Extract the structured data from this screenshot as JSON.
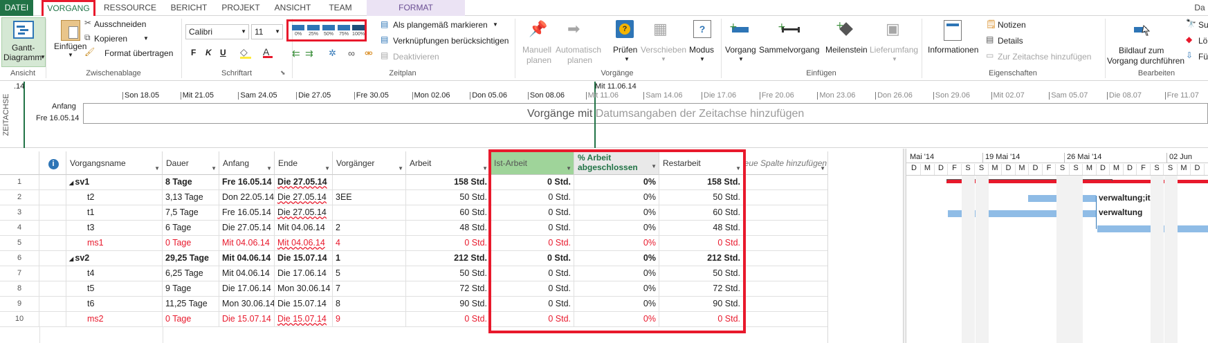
{
  "tabs": [
    {
      "label": "DATEI"
    },
    {
      "label": "VORGANG"
    },
    {
      "label": "RESSOURCE"
    },
    {
      "label": "BERICHT"
    },
    {
      "label": "PROJEKT"
    },
    {
      "label": "ANSICHT"
    },
    {
      "label": "TEAM"
    },
    {
      "label": "FORMAT"
    },
    {
      "label": "Da"
    }
  ],
  "ribbon": {
    "ansicht": {
      "gantt_line1": "Gantt-",
      "gantt_line2": "Diagramm",
      "group": "Ansicht"
    },
    "zwischenablage": {
      "paste": "Einfügen",
      "cut": "Ausschneiden",
      "copy": "Kopieren",
      "format_painter": "Format übertragen",
      "group": "Zwischenablage"
    },
    "schriftart": {
      "font": "Calibri",
      "size": "11",
      "bold": "F",
      "italic": "K",
      "underline": "U",
      "group": "Schriftart"
    },
    "zeitplan": {
      "pct": [
        "0%",
        "25%",
        "50%",
        "75%",
        "100%"
      ],
      "mark_on_track": "Als plangemäß markieren",
      "respect_links": "Verknüpfungen berücksichtigen",
      "deactivate": "Deaktivieren",
      "group": "Zeitplan"
    },
    "vorgaenge": {
      "manual1": "Manuell",
      "manual2": "planen",
      "auto1": "Automatisch",
      "auto2": "planen",
      "inspect": "Prüfen",
      "move": "Verschieben",
      "mode": "Modus",
      "group": "Vorgänge"
    },
    "einfuegen": {
      "task": "Vorgang",
      "summary": "Sammelvorgang",
      "milestone": "Meilenstein",
      "deliverable": "Lieferumfang",
      "group": "Einfügen"
    },
    "eigenschaften": {
      "info": "Informationen",
      "notes": "Notizen",
      "details": "Details",
      "add_timeline": "Zur Zeitachse hinzufügen",
      "group": "Eigenschaften"
    },
    "bearbeiten": {
      "scroll1": "Bildlauf zum",
      "scroll2": "Vorgang durchführen",
      "su": "Su",
      "lo": "Lö",
      "fu": "Fü",
      "group": "Bearbeiten"
    }
  },
  "timeline": {
    "side_label": "ZEITACHSE",
    "start_label": "Anfang",
    "start_date": "Fre 16.05.14",
    "left_mark": ".14",
    "today": "Mit 11.06.14",
    "placeholder_a": "Vorgänge mit",
    "placeholder_b": " Datumsangaben der Zeitachse hinzufügen",
    "ticks": [
      "Son 18.05",
      "Mit 21.05",
      "Sam 24.05",
      "Die 27.05",
      "Fre 30.05",
      "Mon 02.06",
      "Don 05.06",
      "Son 08.06",
      "Mit 11.06",
      "Sam 14.06",
      "Die 17.06",
      "Fre 20.06",
      "Mon 23.06",
      "Don 26.06",
      "Son 29.06",
      "Mit 02.07",
      "Sam 05.07",
      "Die 08.07",
      "Fre 11.07"
    ]
  },
  "table": {
    "headers": {
      "info": "i",
      "name": "Vorgangsname",
      "dauer": "Dauer",
      "anfang": "Anfang",
      "ende": "Ende",
      "vorg": "Vorgänger",
      "arbeit": "Arbeit",
      "ist": "Ist-Arbeit",
      "pct1": "% Arbeit",
      "pct2": "abgeschlossen",
      "rest": "Restarbeit",
      "add": "Neue Spalte hinzufügen"
    },
    "rows": [
      {
        "id": "1",
        "name": "sv1",
        "dauer": "8 Tage",
        "anfang": "Fre 16.05.14",
        "ende": "Die 27.05.14",
        "vorg": "",
        "arbeit": "158 Std.",
        "ist": "0 Std.",
        "pct": "0%",
        "rest": "158 Std."
      },
      {
        "id": "2",
        "name": "t2",
        "dauer": "3,13 Tage",
        "anfang": "Don 22.05.14",
        "ende": "Die 27.05.14",
        "vorg": "3EE",
        "arbeit": "50 Std.",
        "ist": "0 Std.",
        "pct": "0%",
        "rest": "50 Std."
      },
      {
        "id": "3",
        "name": "t1",
        "dauer": "7,5 Tage",
        "anfang": "Fre 16.05.14",
        "ende": "Die 27.05.14",
        "vorg": "",
        "arbeit": "60 Std.",
        "ist": "0 Std.",
        "pct": "0%",
        "rest": "60 Std."
      },
      {
        "id": "4",
        "name": "t3",
        "dauer": "6 Tage",
        "anfang": "Die 27.05.14",
        "ende": "Mit 04.06.14",
        "vorg": "2",
        "arbeit": "48 Std.",
        "ist": "0 Std.",
        "pct": "0%",
        "rest": "48 Std."
      },
      {
        "id": "5",
        "name": "ms1",
        "dauer": "0 Tage",
        "anfang": "Mit 04.06.14",
        "ende": "Mit 04.06.14",
        "vorg": "4",
        "arbeit": "0 Std.",
        "ist": "0 Std.",
        "pct": "0%",
        "rest": "0 Std."
      },
      {
        "id": "6",
        "name": "sv2",
        "dauer": "29,25 Tage",
        "anfang": "Mit 04.06.14",
        "ende": "Die 15.07.14",
        "vorg": "1",
        "arbeit": "212 Std.",
        "ist": "0 Std.",
        "pct": "0%",
        "rest": "212 Std."
      },
      {
        "id": "7",
        "name": "t4",
        "dauer": "6,25 Tage",
        "anfang": "Mit 04.06.14",
        "ende": "Die 17.06.14",
        "vorg": "5",
        "arbeit": "50 Std.",
        "ist": "0 Std.",
        "pct": "0%",
        "rest": "50 Std."
      },
      {
        "id": "8",
        "name": "t5",
        "dauer": "9 Tage",
        "anfang": "Die 17.06.14",
        "ende": "Mon 30.06.14",
        "vorg": "7",
        "arbeit": "72 Std.",
        "ist": "0 Std.",
        "pct": "0%",
        "rest": "72 Std."
      },
      {
        "id": "9",
        "name": "t6",
        "dauer": "11,25 Tage",
        "anfang": "Mon 30.06.14",
        "ende": "Die 15.07.14",
        "vorg": "8",
        "arbeit": "90 Std.",
        "ist": "0 Std.",
        "pct": "0%",
        "rest": "90 Std."
      },
      {
        "id": "10",
        "name": "ms2",
        "dauer": "0 Tage",
        "anfang": "Die 15.07.14",
        "ende": "Die 15.07.14",
        "vorg": "9",
        "arbeit": "0 Std.",
        "ist": "0 Std.",
        "pct": "0%",
        "rest": "0 Std."
      }
    ]
  },
  "gantt": {
    "weeks": [
      "Mai '14",
      "19 Mai '14",
      "26 Mai '14",
      "02 Jun"
    ],
    "days": [
      "D",
      "M",
      "D",
      "F",
      "S",
      "S",
      "M",
      "D",
      "M",
      "D",
      "F",
      "S",
      "S",
      "M",
      "D",
      "M",
      "D",
      "F",
      "S",
      "S",
      "M",
      "D"
    ],
    "label_row2": "verwaltung;it",
    "label_row3": "verwaltung"
  },
  "colors": {
    "accent": "#217346",
    "highlight": "#e8192c",
    "bar": "#8fbce6",
    "ist_header": "#9fd49a"
  }
}
